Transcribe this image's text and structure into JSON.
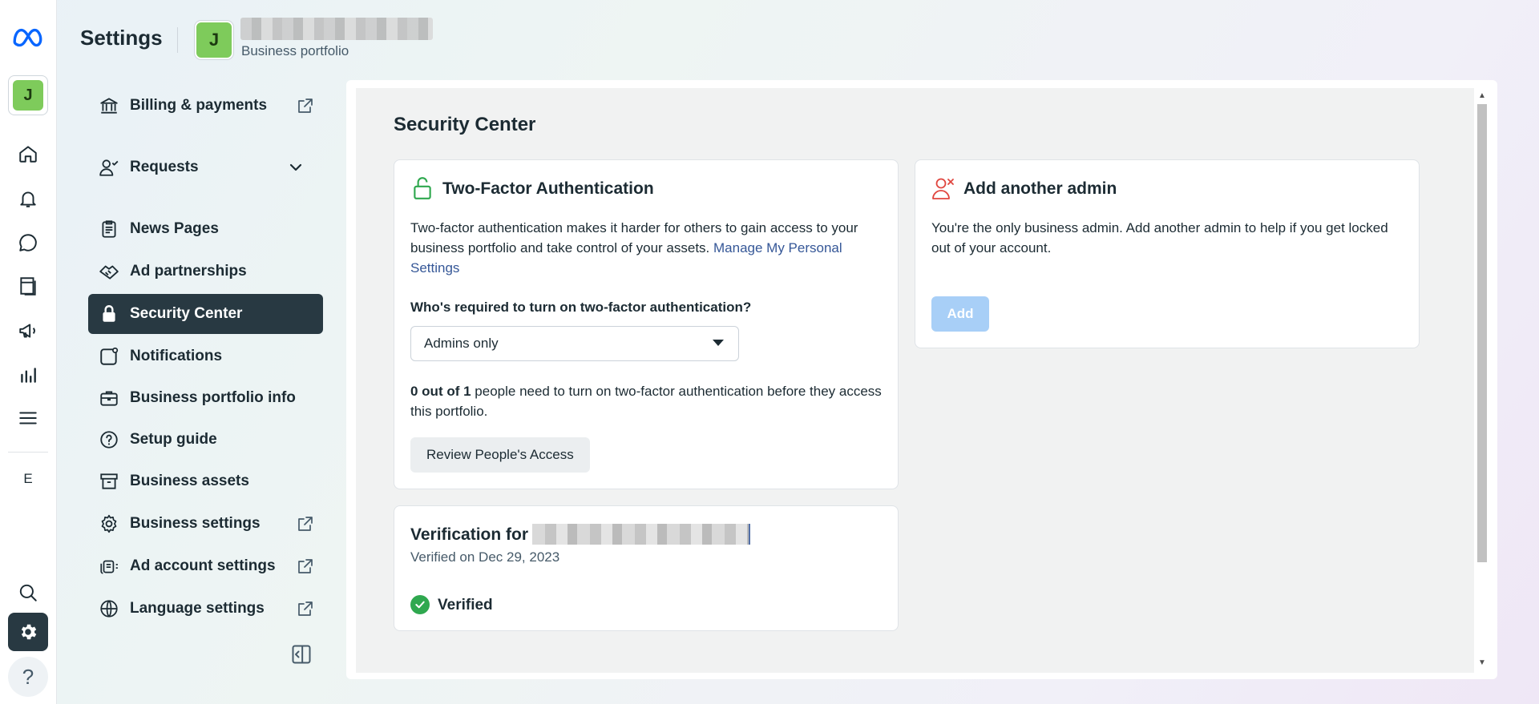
{
  "header": {
    "title": "Settings",
    "portfolio_avatar_letter": "J",
    "portfolio_subtitle": "Business portfolio"
  },
  "rail": {
    "avatar_letter": "J",
    "letter_item": "E",
    "help_symbol": "?"
  },
  "nav": {
    "items": [
      {
        "label": "Billing & payments",
        "icon": "bank-icon",
        "trailing": "external-link-icon"
      },
      {
        "label": "Requests",
        "icon": "person-check-icon",
        "trailing": "chevron-down-icon"
      },
      {
        "label": "News Pages",
        "icon": "clipboard-icon"
      },
      {
        "label": "Ad partnerships",
        "icon": "handshake-icon"
      },
      {
        "label": "Security Center",
        "icon": "lock-icon",
        "active": true
      },
      {
        "label": "Notifications",
        "icon": "notification-square-icon"
      },
      {
        "label": "Business portfolio info",
        "icon": "briefcase-icon"
      },
      {
        "label": "Setup guide",
        "icon": "question-circle-icon"
      },
      {
        "label": "Business assets",
        "icon": "archive-box-icon"
      },
      {
        "label": "Business settings",
        "icon": "gear-icon",
        "trailing": "external-link-icon"
      },
      {
        "label": "Ad account settings",
        "icon": "ad-account-icon",
        "trailing": "external-link-icon"
      },
      {
        "label": "Language settings",
        "icon": "globe-icon",
        "trailing": "external-link-icon"
      }
    ]
  },
  "main": {
    "page_title": "Security Center",
    "two_factor": {
      "title": "Two-Factor Authentication",
      "description": "Two-factor authentication makes it harder for others to gain access to your business portfolio and take control of your assets.",
      "link_label": "Manage My Personal Settings",
      "question": "Who's required to turn on two-factor authentication?",
      "selected_option": "Admins only",
      "status_bold": "0 out of 1",
      "status_text": "people need to turn on two-factor authentication before they access this portfolio.",
      "review_button": "Review People's Access"
    },
    "add_admin": {
      "title": "Add another admin",
      "description": "You're the only business admin. Add another admin to help if you get locked out of your account.",
      "button": "Add"
    },
    "verification": {
      "title_prefix": "Verification for",
      "date_text": "Verified on Dec 29, 2023",
      "status": "Verified"
    }
  },
  "colors": {
    "accent_dark": "#283942",
    "link": "#355797",
    "avatar_green": "#7ecb5b",
    "verified_green": "#2fa84f",
    "admin_icon_red": "#e0463f",
    "unlock_icon_green": "#2fa84f",
    "add_button_disabled": "#a8cff7"
  }
}
